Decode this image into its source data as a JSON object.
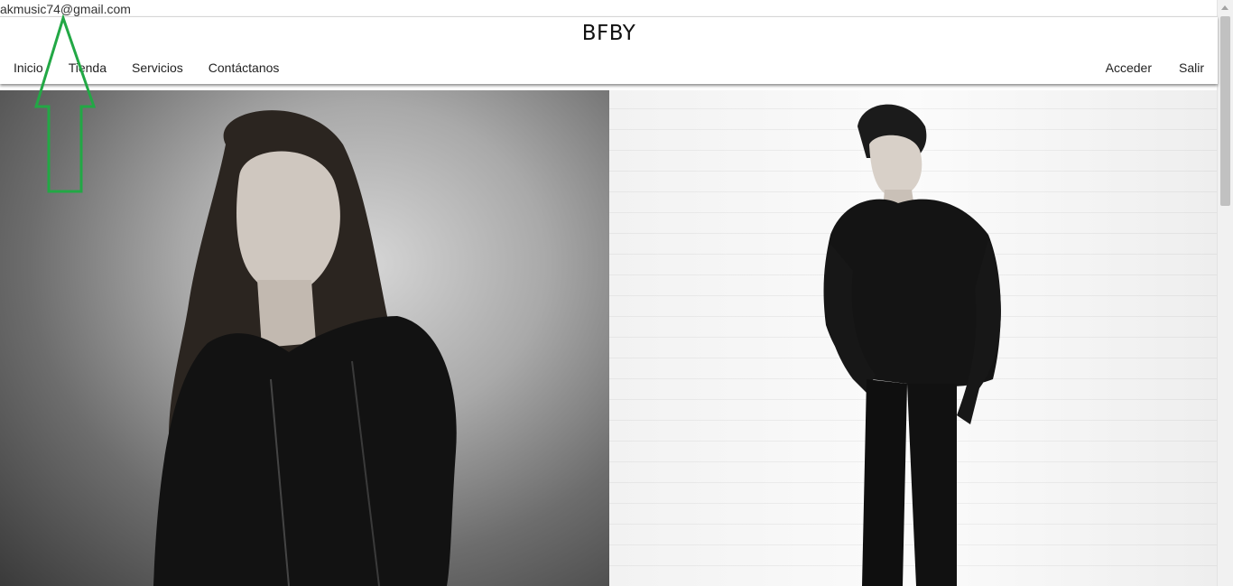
{
  "user": {
    "email": "akmusic74@gmail.com"
  },
  "header": {
    "brand": "BFBY",
    "nav_left": [
      "Inicio",
      "Tienda",
      "Servicios",
      "Contáctanos"
    ],
    "nav_right": [
      "Acceder",
      "Salir"
    ]
  },
  "hero": {
    "left_image": "woman-leather-jacket-photo",
    "right_image": "man-leather-jacket-photo"
  },
  "colors": {
    "annotation": "#22a845",
    "header_bg": "#ffffff",
    "text": "#222222"
  }
}
